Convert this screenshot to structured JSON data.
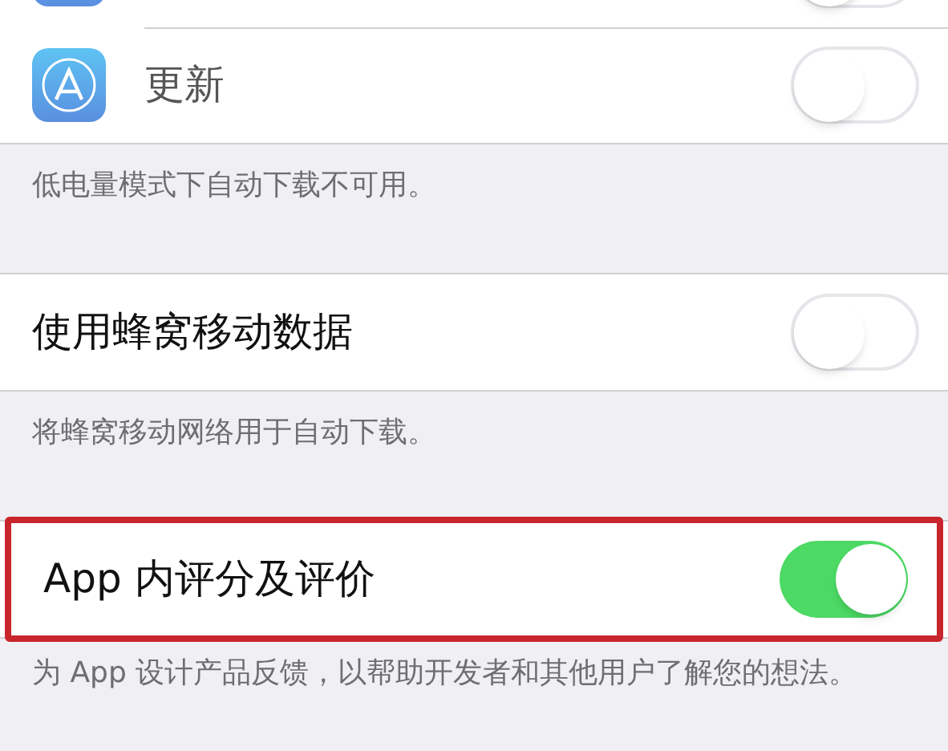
{
  "groups": [
    {
      "rows": [
        {
          "kind": "app",
          "on": false,
          "highlighted": false
        },
        {
          "kind": "app",
          "label": "更新",
          "on": false,
          "highlighted": false
        }
      ],
      "footer": "低电量模式下自动下载不可用。"
    },
    {
      "rows": [
        {
          "kind": "plain",
          "label": "使用蜂窝移动数据",
          "on": false,
          "highlighted": false
        }
      ],
      "footer": "将蜂窝移动网络用于自动下载。"
    },
    {
      "rows": [
        {
          "kind": "plain",
          "label": "App 内评分及评价",
          "on": true,
          "highlighted": true
        }
      ],
      "footer": "为 App 设计产品反馈，以帮助开发者和其他用户了解您的想法。"
    }
  ]
}
